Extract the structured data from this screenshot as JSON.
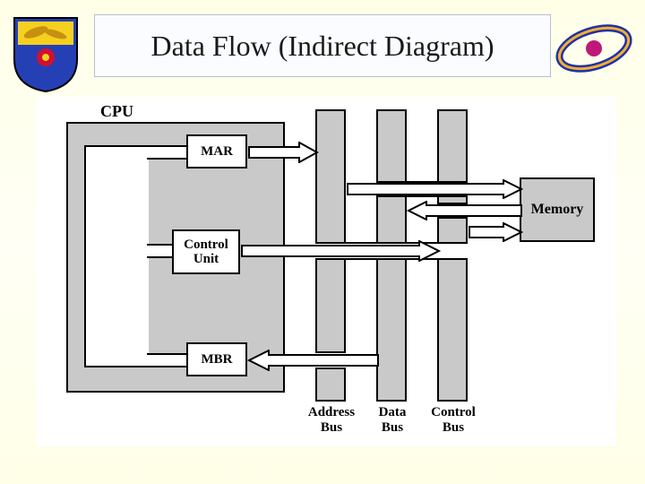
{
  "title": "Data Flow (Indirect Diagram)",
  "labels": {
    "cpu": "CPU",
    "mar": "MAR",
    "cu": "Control\nUnit",
    "mbr": "MBR",
    "memory": "Memory",
    "address_bus": "Address\nBus",
    "data_bus": "Data\nBus",
    "control_bus": "Control\nBus"
  },
  "chart_data": {
    "type": "diagram",
    "title": "Data Flow (Indirect Diagram)",
    "nodes": [
      {
        "id": "cpu",
        "label": "CPU",
        "type": "container"
      },
      {
        "id": "mar",
        "label": "MAR",
        "parent": "cpu"
      },
      {
        "id": "cu",
        "label": "Control Unit",
        "parent": "cpu"
      },
      {
        "id": "mbr",
        "label": "MBR",
        "parent": "cpu"
      },
      {
        "id": "address_bus",
        "label": "Address Bus",
        "type": "bus"
      },
      {
        "id": "data_bus",
        "label": "Data Bus",
        "type": "bus"
      },
      {
        "id": "control_bus",
        "label": "Control Bus",
        "type": "bus"
      },
      {
        "id": "memory",
        "label": "Memory"
      }
    ],
    "edges": [
      {
        "from": "mar",
        "to": "address_bus",
        "direction": "→"
      },
      {
        "from": "cu",
        "to": "control_bus",
        "direction": "→"
      },
      {
        "from": "data_bus",
        "to": "mbr",
        "direction": "→"
      },
      {
        "from": "mar",
        "to": "cu",
        "direction": "internal"
      },
      {
        "from": "cu",
        "to": "mbr",
        "direction": "internal"
      },
      {
        "from": "address_bus",
        "to": "memory",
        "direction": "→"
      },
      {
        "from": "memory",
        "to": "data_bus",
        "direction": "→"
      },
      {
        "from": "control_bus",
        "to": "memory",
        "direction": "→"
      }
    ]
  }
}
